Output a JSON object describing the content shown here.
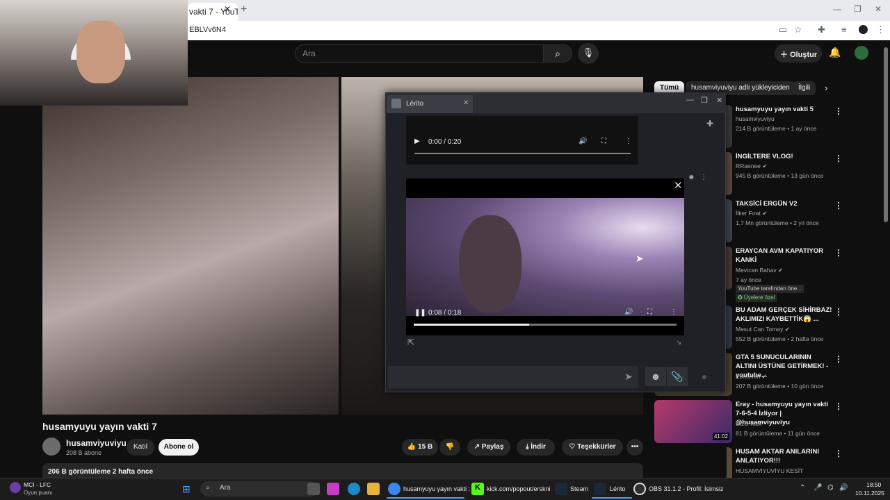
{
  "browser": {
    "tab_title": "vakti 7 - YouT",
    "url": "EBLVv6N4",
    "new_tab": "+",
    "close": "✕",
    "min": "—",
    "max": "❐",
    "winclose": "✕"
  },
  "header": {
    "search_placeholder": "Ara",
    "create_label": "Oluştur",
    "icons": {
      "search": "search-icon",
      "mic": "mic-icon",
      "bell": "bell-icon"
    }
  },
  "video": {
    "title": "husamyuyu yayın vakti 7",
    "channel": "husamviyuviyu",
    "subscribers": "208 B abone",
    "join_label": "Katıl",
    "subscribe_label": "Abone ol",
    "likes": "15 B",
    "share_label": "Paylaş",
    "download_label": "İndir",
    "thanks_label": "Teşekkürler",
    "more": "•••",
    "views_meta": "206 B görüntüleme  2 hafta önce"
  },
  "chips": [
    "Tümü",
    "husamviyuviyu adlı yükleyiciden",
    "İlgili"
  ],
  "recommendations": [
    {
      "title": "husamyuyu yayın vakti 5",
      "channel": "husamviyuviyu",
      "meta": "214 B görüntüleme • 1 ay önce"
    },
    {
      "title": "İNGİLTERE VLOG!",
      "channel": "RRaenee ✔",
      "meta": "945 B görüntüleme • 13 gün önce"
    },
    {
      "title": "TAKSİCİ ERGÜN V2",
      "channel": "İlker Fırat ✔",
      "meta": "1,7 Mn görüntüleme • 2 yıl önce"
    },
    {
      "title": "ERAYCAN AVM KAPATIYOR KANKİ",
      "channel": "Mevtcan Bahav ✔",
      "meta": "7 ay önce",
      "badge1": "YouTube tarafından öne...",
      "badge2": "✪ Üyelere özel"
    },
    {
      "title": "BU ADAM GERÇEK SİHİRBAZ! AKLIMIZI KAYBETTİK😱 ...",
      "channel": "Mesut Can Tomay ✔",
      "meta": "552 B görüntüleme • 2 hafta önce"
    },
    {
      "title": "GTA 5 SUNUCULARININ ALTINI ÜSTÜNE GETİRMEK! - youtube...",
      "channel": "Ebonivon ✔",
      "meta": "207 B görüntüleme • 10 gün önce"
    },
    {
      "title": "Eray - husamyuyu yayın vakti 7-6-5-4 İzliyor | @husamviyuviyu",
      "channel": "Dizcı Kick",
      "meta": "81 B görüntüleme • 11 gün önce",
      "duration": "41:02"
    },
    {
      "title": "HUSAM AKTAR ANILARINI ANLATIYOR!!!",
      "channel": "HUSAMVİYUVİYU KESİT",
      "meta": ""
    }
  ],
  "chat": {
    "tab_name": "Lérito",
    "audio_time": "0:00 / 0:20",
    "video_time": "0:08 / 0:18",
    "video_progress": 0.44
  },
  "taskbar": {
    "widget_title": "MCI - LFC",
    "widget_sub": "Oyun puanı",
    "search_label": "Ara",
    "apps": [
      {
        "label": "husamyuyu yayın vakti :"
      },
      {
        "label": "kick.com/popout/erskni"
      },
      {
        "label": "Steam"
      },
      {
        "label": "Lérito"
      },
      {
        "label": "OBS 31.1.2 - Profil: İsimsiz"
      }
    ],
    "time": "18:50",
    "date": "10.11.2025"
  },
  "colors": {
    "yt_bg": "#0f0f0f",
    "accent": "#4aa3ff",
    "steam_bg": "#1f2126"
  }
}
